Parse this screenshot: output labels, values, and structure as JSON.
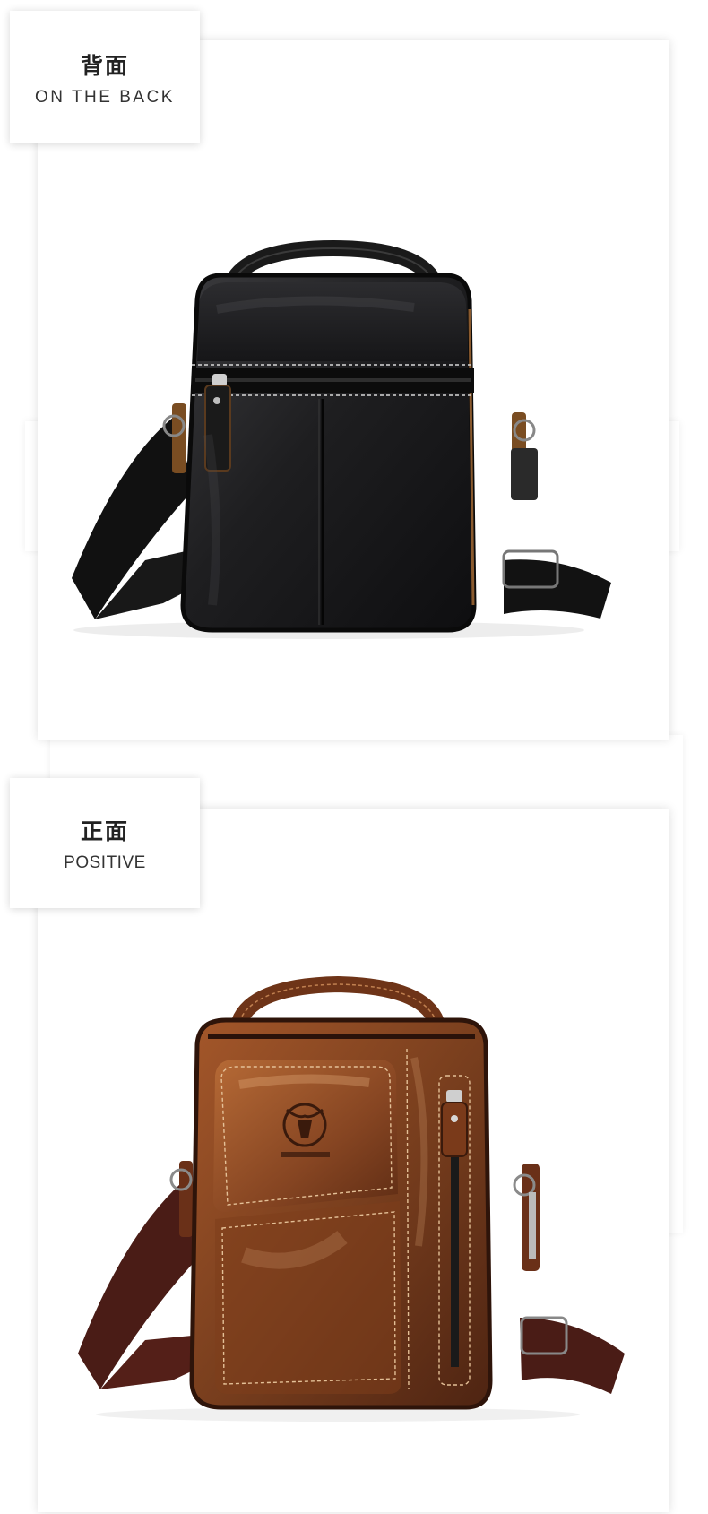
{
  "sections": [
    {
      "title_zh": "背面",
      "title_en": "ON THE BACK",
      "image": {
        "subject": "black-leather-crossbody-bag-back-view",
        "color": "#1c1c1e"
      }
    },
    {
      "title_zh": "正面",
      "title_en": "POSITIVE",
      "image": {
        "subject": "brown-leather-crossbody-bag-front-view",
        "color": "#7a3f1e"
      }
    }
  ],
  "colors": {
    "black_leather": "#1c1c1e",
    "brown_leather": "#7a3f1e",
    "strap_black": "#111111",
    "strap_brown": "#4a1c16",
    "tan_trim": "#8a5a2e",
    "stitch": "#d8b48a"
  }
}
